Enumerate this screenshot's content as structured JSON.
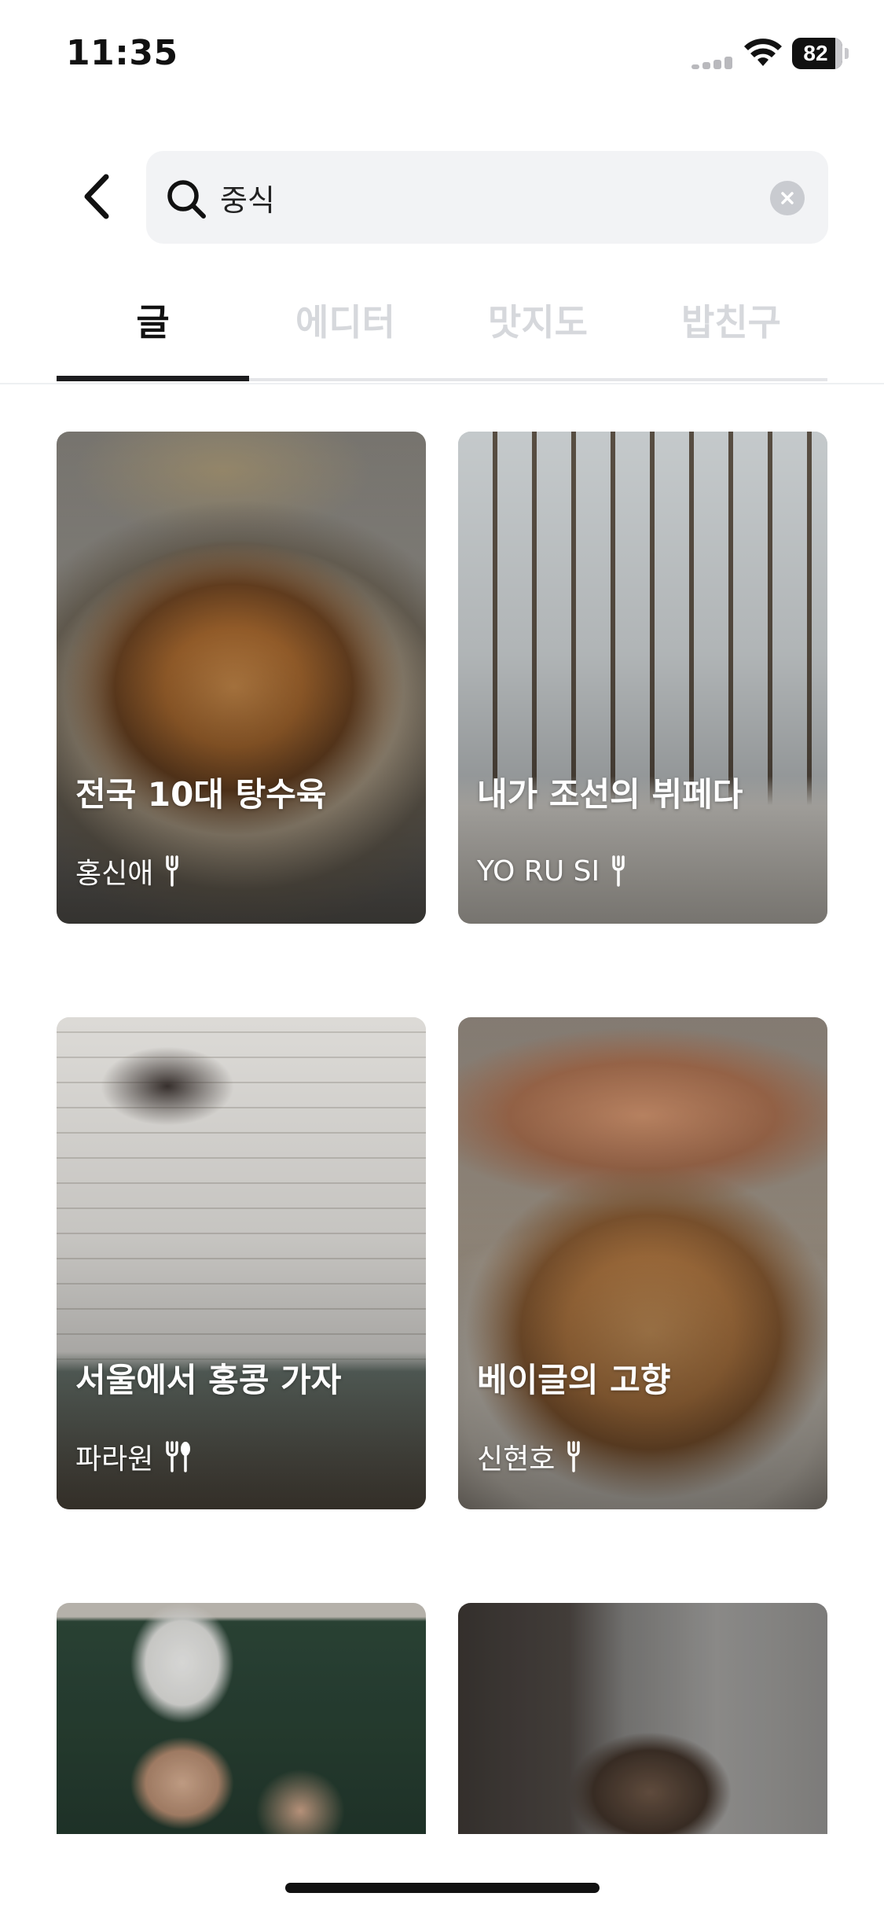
{
  "status_bar": {
    "time": "11:35",
    "battery": "82"
  },
  "search": {
    "query": "중식",
    "placeholder": ""
  },
  "tabs": [
    {
      "label": "글",
      "active": true
    },
    {
      "label": "에디터",
      "active": false
    },
    {
      "label": "맛지도",
      "active": false
    },
    {
      "label": "밥친구",
      "active": false
    }
  ],
  "cards": [
    {
      "title": "전국 10대 탕수육",
      "author": "홍신애",
      "badge_icon": "fork-icon"
    },
    {
      "title": "내가 조선의 뷔페다",
      "author": "YO RU SI",
      "badge_icon": "fork-icon"
    },
    {
      "title": "서울에서 홍콩 가자",
      "author": "파라원",
      "badge_icon": "fork-spoon-icon"
    },
    {
      "title": "베이글의 고향",
      "author": "신현호",
      "badge_icon": "fork-icon"
    },
    {
      "title": "",
      "author": "",
      "badge_icon": ""
    },
    {
      "title": "",
      "author": "",
      "badge_icon": ""
    }
  ],
  "colors": {
    "accent": "#1c1c1e",
    "inactive_tab": "#d6d8dc",
    "search_bg": "#f2f3f5"
  }
}
